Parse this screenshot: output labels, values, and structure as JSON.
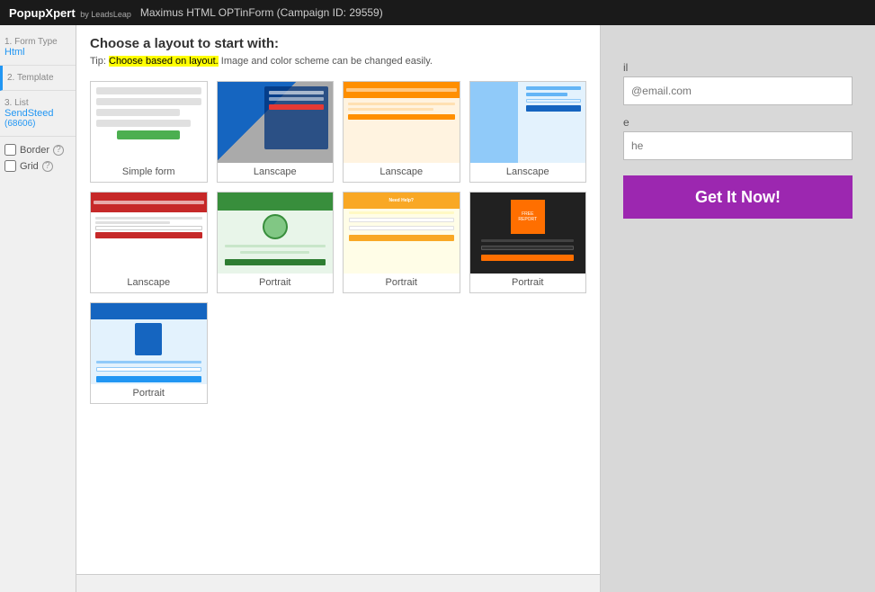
{
  "topbar": {
    "brand": "PopupXpert",
    "brand_sub": "by LeadsLeap",
    "campaign_title": "Maximus HTML OPTinForm (Campaign ID: 29559)"
  },
  "sidebar": {
    "steps": [
      {
        "id": "form-type",
        "num": "1.",
        "label": "Form Type",
        "value": "Html",
        "subvalue": ""
      },
      {
        "id": "template",
        "num": "2.",
        "label": "Template",
        "value": "",
        "subvalue": "",
        "active": true
      },
      {
        "id": "list",
        "num": "3.",
        "label": "List",
        "value": "SendSteed",
        "subvalue": "(68606)"
      }
    ],
    "options": [
      {
        "id": "border",
        "label": "Border",
        "checked": false
      },
      {
        "id": "grid",
        "label": "Grid",
        "checked": false
      }
    ]
  },
  "layout_chooser": {
    "title": "Choose a layout to start with:",
    "tip_prefix": "Tip: ",
    "tip_highlight": "Choose based on layout.",
    "tip_suffix": " Image and color scheme can be changed easily.",
    "layouts": [
      {
        "id": "simple-form",
        "label": "Simple form",
        "type": "simple"
      },
      {
        "id": "lanscape-1",
        "label": "Lanscape",
        "type": "landscape1"
      },
      {
        "id": "lanscape-2",
        "label": "Lanscape",
        "type": "landscape2"
      },
      {
        "id": "lanscape-3",
        "label": "Lanscape",
        "type": "landscape3"
      },
      {
        "id": "lanscape-4",
        "label": "Lanscape",
        "type": "landscape4"
      },
      {
        "id": "portrait-1",
        "label": "Portrait",
        "type": "portrait1"
      },
      {
        "id": "portrait-2",
        "label": "Portrait",
        "type": "portrait2"
      },
      {
        "id": "portrait-3",
        "label": "Portrait",
        "type": "portrait3"
      },
      {
        "id": "portrait-4",
        "label": "Portrait",
        "type": "portrait4"
      }
    ]
  },
  "form_preview": {
    "email_label": "il",
    "email_placeholder": "@email.com",
    "name_label": "e",
    "name_placeholder": "he",
    "submit_label": "Get It Now!"
  }
}
